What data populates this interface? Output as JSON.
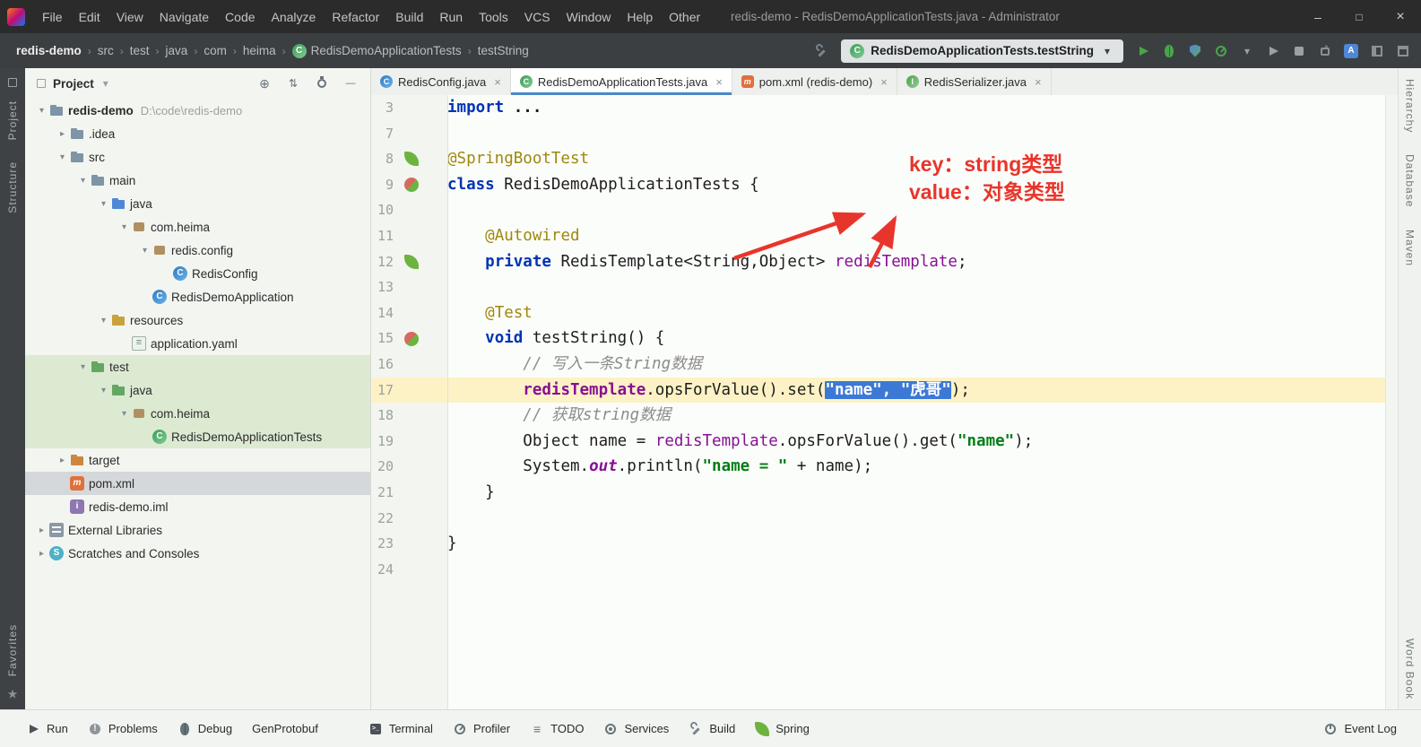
{
  "colors": {
    "accent_blue": "#4a88c7",
    "selection_blue": "#3c79d6",
    "line_highlight": "#fdf2c5",
    "tree_highlight_green": "#dcead2",
    "annotation_red": "#e8352b",
    "spring_green": "#6db33f"
  },
  "titlebar": {
    "menus": [
      "File",
      "Edit",
      "View",
      "Navigate",
      "Code",
      "Analyze",
      "Refactor",
      "Build",
      "Run",
      "Tools",
      "VCS",
      "Window",
      "Help",
      "Other"
    ],
    "title": "redis-demo - RedisDemoApplicationTests.java - Administrator",
    "controls": [
      "minimize",
      "maximize",
      "close"
    ]
  },
  "navbar": {
    "breadcrumbs": [
      {
        "label": "redis-demo",
        "bold": true
      },
      {
        "label": "src"
      },
      {
        "label": "test"
      },
      {
        "label": "java"
      },
      {
        "label": "com"
      },
      {
        "label": "heima"
      },
      {
        "label": "RedisDemoApplicationTests",
        "icon": "testclass"
      },
      {
        "label": "testString"
      }
    ],
    "run_config": "RedisDemoApplicationTests.testString",
    "icons_before_config": [
      "build-hammer"
    ],
    "icons_after_config": [
      "run",
      "debug",
      "coverage",
      "profiler",
      "profiler-dropdown",
      "rerun-disabled",
      "stop-disabled",
      "run-anything",
      "translate",
      "layout",
      "window-tool"
    ]
  },
  "stripes": {
    "left_top": [
      "Project",
      "Structure"
    ],
    "left_bottom": [
      "Favorites"
    ],
    "right_top": [
      "Hierarchy",
      "Database",
      "Maven"
    ],
    "right_bottom": [
      "Word Book"
    ]
  },
  "project": {
    "header": {
      "label": "Project",
      "icons": [
        "locate",
        "collapse-all",
        "settings",
        "hide"
      ]
    },
    "tree": [
      {
        "label": "redis-demo",
        "suffix": "D:\\code\\redis-demo",
        "depth": 0,
        "chevron": "down",
        "icon": "folder",
        "bold": true
      },
      {
        "label": ".idea",
        "depth": 1,
        "chevron": "right",
        "icon": "folder"
      },
      {
        "label": "src",
        "depth": 1,
        "chevron": "down",
        "icon": "folder"
      },
      {
        "label": "main",
        "depth": 2,
        "chevron": "down",
        "icon": "folder"
      },
      {
        "label": "java",
        "depth": 3,
        "chevron": "down",
        "icon": "folder-source"
      },
      {
        "label": "com.heima",
        "depth": 4,
        "chevron": "down",
        "icon": "package"
      },
      {
        "label": "redis.config",
        "depth": 5,
        "chevron": "down",
        "icon": "package"
      },
      {
        "label": "RedisConfig",
        "depth": 6,
        "chevron": "none",
        "icon": "class"
      },
      {
        "label": "RedisDemoApplication",
        "depth": 5,
        "chevron": "none",
        "icon": "class-main"
      },
      {
        "label": "resources",
        "depth": 3,
        "chevron": "down",
        "icon": "folder-resources"
      },
      {
        "label": "application.yaml",
        "depth": 4,
        "chevron": "none",
        "icon": "yaml"
      },
      {
        "label": "test",
        "depth": 2,
        "chevron": "down",
        "icon": "folder-test",
        "highlight": true
      },
      {
        "label": "java",
        "depth": 3,
        "chevron": "down",
        "icon": "folder-test",
        "highlight": true
      },
      {
        "label": "com.heima",
        "depth": 4,
        "chevron": "down",
        "icon": "package",
        "highlight": true
      },
      {
        "label": "RedisDemoApplicationTests",
        "depth": 5,
        "chevron": "none",
        "icon": "testclass",
        "highlight": true
      },
      {
        "label": "target",
        "depth": 1,
        "chevron": "right",
        "icon": "folder-excluded"
      },
      {
        "label": "pom.xml",
        "depth": 1,
        "chevron": "none",
        "icon": "maven",
        "selected": true
      },
      {
        "label": "redis-demo.iml",
        "depth": 1,
        "chevron": "none",
        "icon": "iml"
      },
      {
        "label": "External Libraries",
        "depth": 0,
        "chevron": "right",
        "icon": "library"
      },
      {
        "label": "Scratches and Consoles",
        "depth": 0,
        "chevron": "right",
        "icon": "scratches"
      }
    ]
  },
  "tabs": [
    {
      "label": "RedisConfig.java",
      "icon": "class"
    },
    {
      "label": "RedisDemoApplicationTests.java",
      "icon": "testclass",
      "selected": true
    },
    {
      "label": "pom.xml (redis-demo)",
      "icon": "maven"
    },
    {
      "label": "RedisSerializer.java",
      "icon": "interface"
    }
  ],
  "editor": {
    "annotation": [
      "key：string类型",
      "value：对象类型"
    ],
    "lines": [
      {
        "num": "3",
        "gutter": "",
        "tokens": [
          {
            "t": "import ",
            "s": "kw"
          },
          {
            "t": "...",
            "s": "fold"
          }
        ]
      },
      {
        "num": "7",
        "gutter": "",
        "tokens": []
      },
      {
        "num": "8",
        "gutter": "spring-leaf",
        "tokens": [
          {
            "t": "@SpringBootTest",
            "s": "ann"
          }
        ]
      },
      {
        "num": "9",
        "gutter": "run-class",
        "tokens": [
          {
            "t": "class ",
            "s": "kw"
          },
          {
            "t": "RedisDemoApplicationTests {",
            "s": "pl"
          }
        ]
      },
      {
        "num": "10",
        "gutter": "",
        "tokens": []
      },
      {
        "num": "11",
        "gutter": "",
        "tokens": [
          {
            "t": "    ",
            "s": "pl"
          },
          {
            "t": "@Autowired",
            "s": "ann"
          }
        ]
      },
      {
        "num": "12",
        "gutter": "spring-bean",
        "tokens": [
          {
            "t": "    ",
            "s": "pl"
          },
          {
            "t": "private ",
            "s": "kw"
          },
          {
            "t": "RedisTemplate<String,Object> ",
            "s": "pl"
          },
          {
            "t": "redisTemplate",
            "s": "field"
          },
          {
            "t": ";",
            "s": "pl"
          }
        ]
      },
      {
        "num": "13",
        "gutter": "",
        "tokens": []
      },
      {
        "num": "14",
        "gutter": "",
        "tokens": [
          {
            "t": "    ",
            "s": "pl"
          },
          {
            "t": "@Test",
            "s": "ann"
          }
        ]
      },
      {
        "num": "15",
        "gutter": "run-test",
        "tokens": [
          {
            "t": "    ",
            "s": "pl"
          },
          {
            "t": "void ",
            "s": "kw"
          },
          {
            "t": "testString() {",
            "s": "pl"
          }
        ]
      },
      {
        "num": "16",
        "gutter": "",
        "tokens": [
          {
            "t": "        ",
            "s": "pl"
          },
          {
            "t": "// 写入一条String数据",
            "s": "cmt"
          }
        ]
      },
      {
        "num": "17",
        "gutter": "",
        "highlight": true,
        "tokens": [
          {
            "t": "        ",
            "s": "pl"
          },
          {
            "t": "redisTemplate",
            "s": "fieldb"
          },
          {
            "t": ".opsForValue().set(",
            "s": "pl"
          },
          {
            "t": "\"name\", \"虎哥\"",
            "s": "sel"
          },
          {
            "t": ");",
            "s": "pl"
          }
        ]
      },
      {
        "num": "18",
        "gutter": "",
        "tokens": [
          {
            "t": "        ",
            "s": "pl"
          },
          {
            "t": "// 获取string数据",
            "s": "cmt"
          }
        ]
      },
      {
        "num": "19",
        "gutter": "",
        "tokens": [
          {
            "t": "        ",
            "s": "pl"
          },
          {
            "t": "Object name = ",
            "s": "pl"
          },
          {
            "t": "redisTemplate",
            "s": "field"
          },
          {
            "t": ".opsForValue().get(",
            "s": "pl"
          },
          {
            "t": "\"name\"",
            "s": "str"
          },
          {
            "t": ");",
            "s": "pl"
          }
        ]
      },
      {
        "num": "20",
        "gutter": "",
        "tokens": [
          {
            "t": "        ",
            "s": "pl"
          },
          {
            "t": "System.",
            "s": "pl"
          },
          {
            "t": "out",
            "s": "static"
          },
          {
            "t": ".println(",
            "s": "pl"
          },
          {
            "t": "\"name = \"",
            "s": "str"
          },
          {
            "t": " + name);",
            "s": "pl"
          }
        ]
      },
      {
        "num": "21",
        "gutter": "",
        "tokens": [
          {
            "t": "    }",
            "s": "pl"
          }
        ]
      },
      {
        "num": "22",
        "gutter": "",
        "tokens": []
      },
      {
        "num": "23",
        "gutter": "",
        "tokens": [
          {
            "t": "}",
            "s": "pl"
          }
        ]
      },
      {
        "num": "24",
        "gutter": "",
        "tokens": []
      }
    ]
  },
  "bottom_bar": {
    "left": [
      {
        "label": "Run",
        "icon": "run"
      },
      {
        "label": "Problems",
        "icon": "problems"
      },
      {
        "label": "Debug",
        "icon": "debug"
      },
      {
        "label": "GenProtobuf",
        "icon": "none"
      },
      {
        "label": "Terminal",
        "icon": "terminal"
      },
      {
        "label": "Profiler",
        "icon": "profiler"
      },
      {
        "label": "TODO",
        "icon": "todo"
      },
      {
        "label": "Services",
        "icon": "services"
      },
      {
        "label": "Build",
        "icon": "build"
      },
      {
        "label": "Spring",
        "icon": "spring"
      }
    ],
    "right": [
      {
        "label": "Event Log",
        "icon": "event-log"
      }
    ]
  }
}
